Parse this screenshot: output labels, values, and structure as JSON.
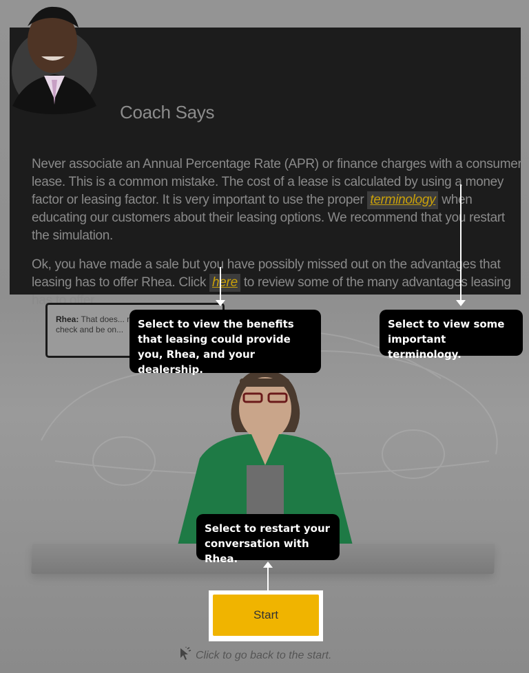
{
  "coach": {
    "title": "Coach Says",
    "para1_a": "Never associate an Annual Percentage Rate (APR) or finance charges with a consumer lease. This is a common mistake. The cost of a lease is calculated by using a money factor or leasing factor. It is very important to use the proper ",
    "terminology_link": "terminology",
    "para1_b": " when educating our customers about their leasing options. We recommend that you restart the simulation.",
    "para2_a": "Ok, you have made a sale but you have possibly missed out on the advantages that leasing has to offer Rhea. Click ",
    "here_link": "here",
    "para2_b": " to review some of the many advantages leasing has to offer."
  },
  "speech": {
    "speaker": "Rhea:",
    "text": "That does... me. I think I'll jus... check and be on..."
  },
  "callouts": {
    "benefits": "Select to view the benefits that leasing could provide you, Rhea, and your dealership.",
    "terminology": "Select to view some important terminology.",
    "restart": "Select to restart your conversation with Rhea."
  },
  "start_button": "Start",
  "hint": "Click to go back to the start.",
  "colors": {
    "panel": "#1c1c1c",
    "link": "#c9a009",
    "button": "#f0b400",
    "callout": "#000000"
  },
  "icons": [
    "coach-avatar",
    "rhea-figure",
    "car-sketch",
    "cursor-icon"
  ]
}
